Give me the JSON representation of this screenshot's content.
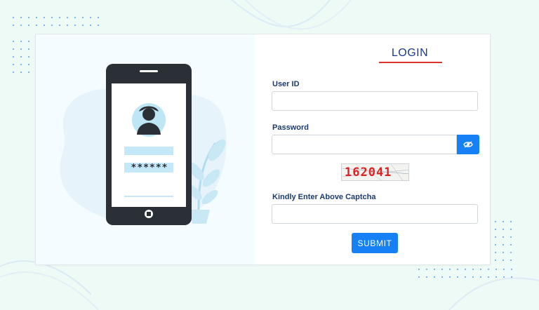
{
  "form": {
    "title": "LOGIN",
    "user_id_label": "User ID",
    "user_id_value": "",
    "password_label": "Password",
    "password_value": "",
    "captcha_code": "162041",
    "captcha_label": "Kindly Enter Above Captcha",
    "captcha_value": "",
    "submit_label": "SUBMIT"
  },
  "illustration": {
    "masked_password": "******"
  },
  "icons": {
    "show_password": "eye-icon",
    "avatar": "user-silhouette-icon",
    "home_button": "phone-home-button-icon"
  },
  "colors": {
    "primary": "#1680f5",
    "title": "#1b3b8f",
    "underline": "#e0322d",
    "captcha_text": "#e32021",
    "background": "#eefaf6"
  }
}
